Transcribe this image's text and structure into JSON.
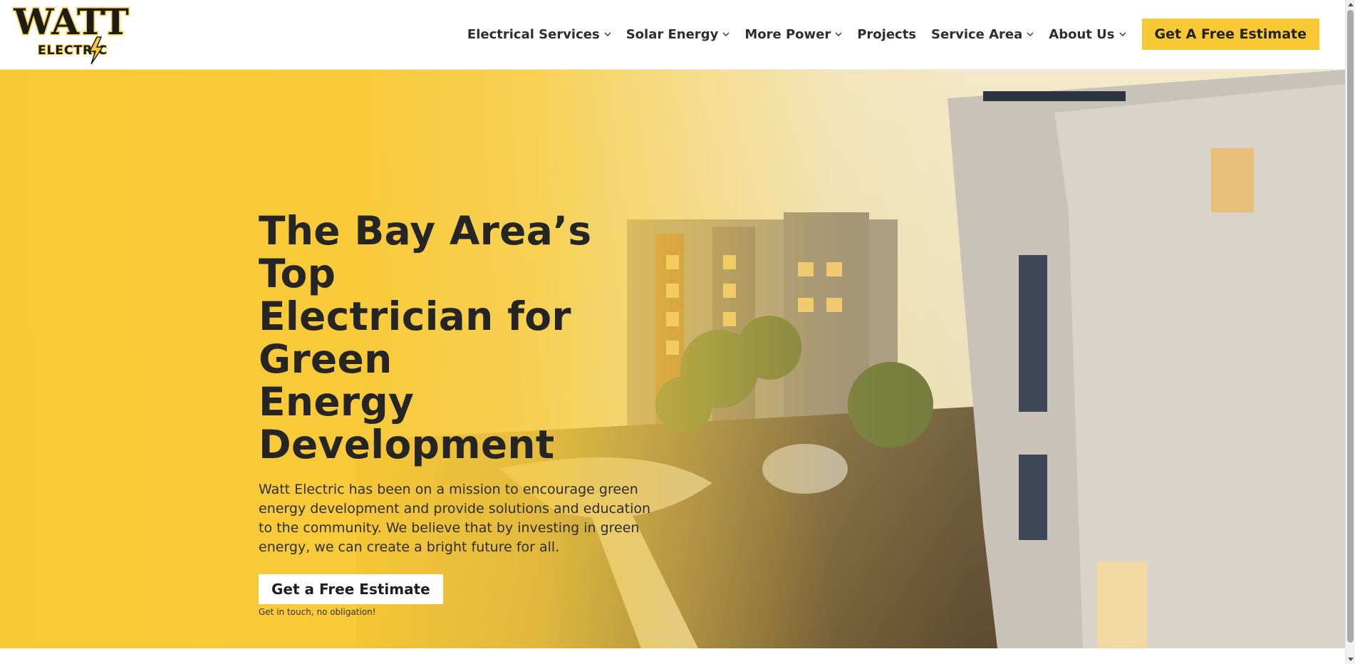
{
  "brand": {
    "logo_top": "WATT",
    "logo_bottom": "ELECTRIC",
    "accent": "#f9c935",
    "dark": "#1b1b1b"
  },
  "nav": {
    "items": [
      {
        "label": "Electrical Services",
        "has_dropdown": true
      },
      {
        "label": "Solar Energy",
        "has_dropdown": true
      },
      {
        "label": "More Power",
        "has_dropdown": true
      },
      {
        "label": "Projects",
        "has_dropdown": false
      },
      {
        "label": "Service Area",
        "has_dropdown": true
      },
      {
        "label": "About Us",
        "has_dropdown": true
      }
    ],
    "cta_label": "Get A Free Estimate"
  },
  "hero": {
    "title_line1": "The Bay Area’s Top",
    "title_line2": "Electrician for Green",
    "title_line3": "Energy Development",
    "text": "Watt Electric has been on a mission to encourage green energy development and provide solutions and education to the community. We believe that by investing in green energy, we can create a bright future for all.",
    "button_label": "Get a Free Estimate",
    "note": "Get in touch, no obligation!"
  },
  "icons": {
    "dropdown": "chevron-down-icon",
    "scroll_up": "arrow-up-icon",
    "scroll_down": "arrow-down-icon"
  }
}
